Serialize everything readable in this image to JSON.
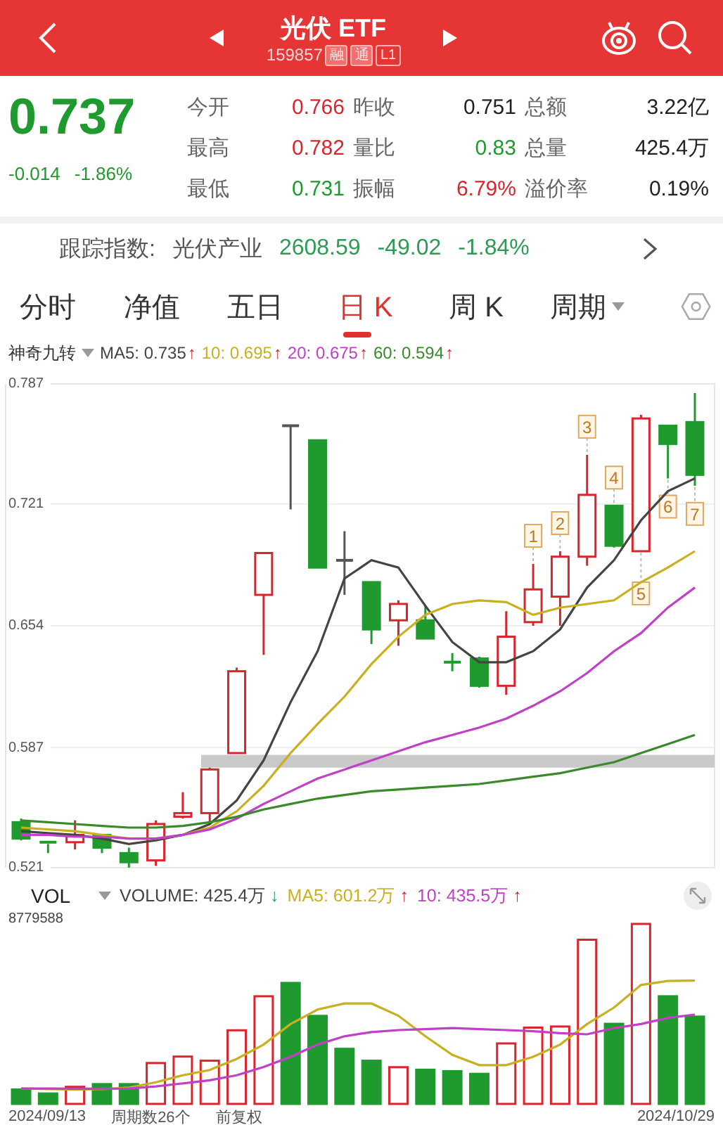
{
  "header": {
    "title": "光伏 ETF",
    "code": "159857",
    "badges": [
      {
        "label": "融",
        "kind": "filled"
      },
      {
        "label": "通",
        "kind": "filled"
      },
      {
        "label": "L1",
        "kind": "outline"
      }
    ]
  },
  "quote": {
    "price": "0.737",
    "change": "-0.014",
    "change_pct": "-1.86%",
    "color": "#1f9a2e",
    "stats": [
      {
        "label": "今开",
        "value": "0.766",
        "color": "#d8262c"
      },
      {
        "label": "昨收",
        "value": "0.751",
        "color": "#222222"
      },
      {
        "label": "总额",
        "value": "3.22亿",
        "color": "#222222"
      },
      {
        "label": "最高",
        "value": "0.782",
        "color": "#d8262c"
      },
      {
        "label": "量比",
        "value": "0.83",
        "color": "#1f9a2e"
      },
      {
        "label": "总量",
        "value": "425.4万",
        "color": "#222222"
      },
      {
        "label": "最低",
        "value": "0.731",
        "color": "#1f9a2e"
      },
      {
        "label": "振幅",
        "value": "6.79%",
        "color": "#d8262c"
      },
      {
        "label": "溢价率",
        "value": "0.19%",
        "color": "#222222"
      }
    ]
  },
  "tracking": {
    "label": "跟踪指数:",
    "index": "光伏产业",
    "value": "2608.59",
    "change": "-49.02",
    "change_pct": "-1.84%",
    "color": "#2e9a55"
  },
  "tabs": [
    {
      "label": "分时",
      "selected": false,
      "dropdown": false
    },
    {
      "label": "净值",
      "selected": false,
      "dropdown": false
    },
    {
      "label": "五日",
      "selected": false,
      "dropdown": false
    },
    {
      "label": "日 K",
      "selected": true,
      "dropdown": false
    },
    {
      "label": "周 K",
      "selected": false,
      "dropdown": false
    },
    {
      "label": "周期",
      "selected": false,
      "dropdown": true
    }
  ],
  "price_panel": {
    "indicator": "神奇九转",
    "legend": [
      {
        "label": "MA5: 0.735",
        "arrow": "↑",
        "color": "#444444"
      },
      {
        "label": "10: 0.695",
        "arrow": "↑",
        "color": "#c8b020"
      },
      {
        "label": "20: 0.675",
        "arrow": "↑",
        "color": "#c040c8"
      },
      {
        "label": "60: 0.594",
        "arrow": "↑",
        "color": "#3a8a2a"
      }
    ],
    "chart_data": {
      "type": "candlestick",
      "ylim": [
        0.521,
        0.787
      ],
      "yticks": [
        0.787,
        0.721,
        0.654,
        0.587,
        0.521
      ],
      "grid": true,
      "series": [
        {
          "type": "candlestick",
          "ohlc": [
            [
              0.546,
              0.548,
              0.536,
              0.537
            ],
            [
              0.535,
              0.535,
              0.529,
              0.534
            ],
            [
              0.535,
              0.547,
              0.531,
              0.539
            ],
            [
              0.539,
              0.539,
              0.529,
              0.532
            ],
            [
              0.529,
              0.532,
              0.521,
              0.524
            ],
            [
              0.525,
              0.547,
              0.522,
              0.545
            ],
            [
              0.549,
              0.5625,
              0.548,
              0.551
            ],
            [
              0.551,
              0.576,
              0.545,
              0.575
            ],
            [
              0.584,
              0.631,
              0.584,
              0.629
            ],
            [
              0.671,
              0.694,
              0.638,
              0.694
            ],
            [
              0.764,
              0.7645,
              0.718,
              0.764
            ],
            [
              0.756,
              0.756,
              0.686,
              0.686
            ],
            [
              0.69,
              0.706,
              0.671,
              0.69
            ],
            [
              0.678,
              0.678,
              0.644,
              0.652
            ],
            [
              0.657,
              0.668,
              0.643,
              0.666
            ],
            [
              0.657,
              0.665,
              0.647,
              0.647
            ],
            [
              0.634,
              0.639,
              0.629,
              0.6335
            ],
            [
              0.636,
              0.637,
              0.62,
              0.621
            ],
            [
              0.621,
              0.662,
              0.616,
              0.648
            ],
            [
              0.656,
              0.688,
              0.654,
              0.674
            ],
            [
              0.67,
              0.695,
              0.654,
              0.692
            ],
            [
              0.692,
              0.748,
              0.687,
              0.726
            ],
            [
              0.72,
              0.72,
              0.697,
              0.698
            ],
            [
              0.695,
              0.77,
              0.695,
              0.768
            ],
            [
              0.764,
              0.764,
              0.735,
              0.754
            ],
            [
              0.766,
              0.782,
              0.731,
              0.737
            ]
          ]
        },
        {
          "type": "line",
          "color": "#444444",
          "values": [
            0.541,
            0.54,
            0.539,
            0.537,
            0.534,
            0.536,
            0.539,
            0.545,
            0.558,
            0.58,
            0.612,
            0.64,
            0.68,
            0.69,
            0.686,
            0.665,
            0.645,
            0.634,
            0.634,
            0.64,
            0.652,
            0.675,
            0.69,
            0.712,
            0.728,
            0.735
          ]
        },
        {
          "type": "line",
          "color": "#c8b020",
          "values": [
            0.543,
            0.542,
            0.541,
            0.539,
            0.537,
            0.537,
            0.539,
            0.543,
            0.552,
            0.566,
            0.584,
            0.6,
            0.615,
            0.633,
            0.648,
            0.66,
            0.666,
            0.668,
            0.667,
            0.66,
            0.664,
            0.666,
            0.668,
            0.678,
            0.686,
            0.695
          ]
        },
        {
          "type": "line",
          "color": "#c040c8",
          "values": [
            0.539,
            0.539,
            0.538,
            0.538,
            0.537,
            0.537,
            0.539,
            0.542,
            0.548,
            0.556,
            0.563,
            0.57,
            0.575,
            0.58,
            0.585,
            0.59,
            0.594,
            0.598,
            0.603,
            0.61,
            0.618,
            0.628,
            0.64,
            0.65,
            0.664,
            0.675
          ]
        },
        {
          "type": "line",
          "color": "#3a8a2a",
          "values": [
            0.547,
            0.546,
            0.545,
            0.544,
            0.543,
            0.543,
            0.544,
            0.546,
            0.549,
            0.553,
            0.556,
            0.559,
            0.561,
            0.563,
            0.564,
            0.565,
            0.566,
            0.567,
            0.569,
            0.571,
            0.573,
            0.576,
            0.579,
            0.584,
            0.589,
            0.594
          ]
        }
      ]
    },
    "nine_turn_labels": [
      {
        "label": "1",
        "below": false
      },
      {
        "label": "2",
        "below": false
      },
      {
        "label": "3",
        "below": false
      },
      {
        "label": "4",
        "below": false
      },
      {
        "label": "5",
        "below": true
      },
      {
        "label": "6",
        "below": true
      },
      {
        "label": "7",
        "below": true
      }
    ]
  },
  "volume_panel": {
    "name": "VOL",
    "legend": [
      {
        "label": "VOLUME: 425.4万",
        "arrow": "↓",
        "color": "#444444",
        "falling": true
      },
      {
        "label": "MA5: 601.2万",
        "arrow": "↑",
        "color": "#c8b020",
        "falling": false
      },
      {
        "label": "10: 435.5万",
        "arrow": "↑",
        "color": "#c040c8",
        "falling": false
      }
    ],
    "scale_label": "8779588",
    "footer": {
      "start_date": "2024/09/13",
      "period_count": "周期数26个",
      "adjust": "前复权",
      "end_date": "2024/10/29"
    }
  }
}
